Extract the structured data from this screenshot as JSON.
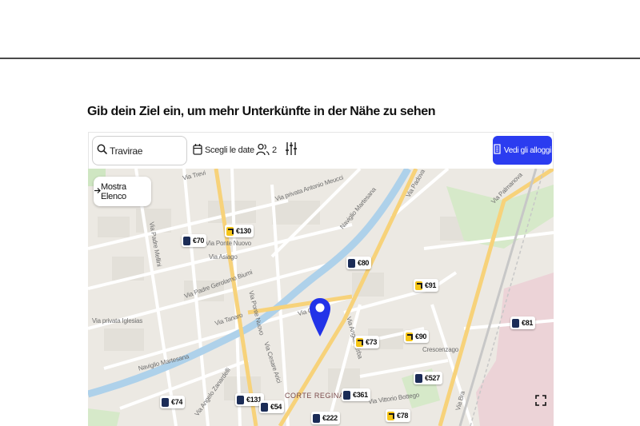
{
  "heading": "Gib dein Ziel ein, um mehr Unterkünfte in der Nähe zu sehen",
  "toolbar": {
    "search_value": "Travirae",
    "dates_label": "Scegli le date",
    "guests_count": "2",
    "view_button": "Vedi gli alloggi"
  },
  "map": {
    "list_button": "Mostra Elenco",
    "streets": [
      "Via Trevi",
      "Via privata Antonio Meucci",
      "Naviglio Martesana",
      "Via Padova",
      "Via Padre Mellini",
      "Via Ponte Nuovo",
      "Via Asiago",
      "Via Padre Gerolamo Biumi",
      "Via privata Iglesias",
      "Via Tanaro",
      "Via Ponte Nuovo",
      "Via Gio",
      "Via Angelo Erba",
      "Via Palmanova",
      "Crescenzago",
      "Naviglio Martesana",
      "Via Cesare Arici",
      "CORTE REGINA",
      "Via Vittorio Bottego",
      "Via Angelo Zanardelli",
      "Via Bra"
    ],
    "prices": [
      {
        "label": "€130",
        "icon": "yellow"
      },
      {
        "label": "€70",
        "icon": "navy"
      },
      {
        "label": "€80",
        "icon": "navy"
      },
      {
        "label": "€91",
        "icon": "yellow"
      },
      {
        "label": "€81",
        "icon": "navy"
      },
      {
        "label": "€73",
        "icon": "yellow"
      },
      {
        "label": "€90",
        "icon": "yellow"
      },
      {
        "label": "€527",
        "icon": "navy"
      },
      {
        "label": "€361",
        "icon": "navy"
      },
      {
        "label": "€131",
        "icon": "navy"
      },
      {
        "label": "€54",
        "icon": "navy"
      },
      {
        "label": "€74",
        "icon": "navy"
      },
      {
        "label": "€222",
        "icon": "navy"
      },
      {
        "label": "€78",
        "icon": "yellow"
      }
    ],
    "colors": {
      "accent": "#2b3cf0",
      "pin": "#2233e8",
      "water": "#aed1ea",
      "major_road": "#f7d27a",
      "park": "#cfe6c2"
    }
  }
}
